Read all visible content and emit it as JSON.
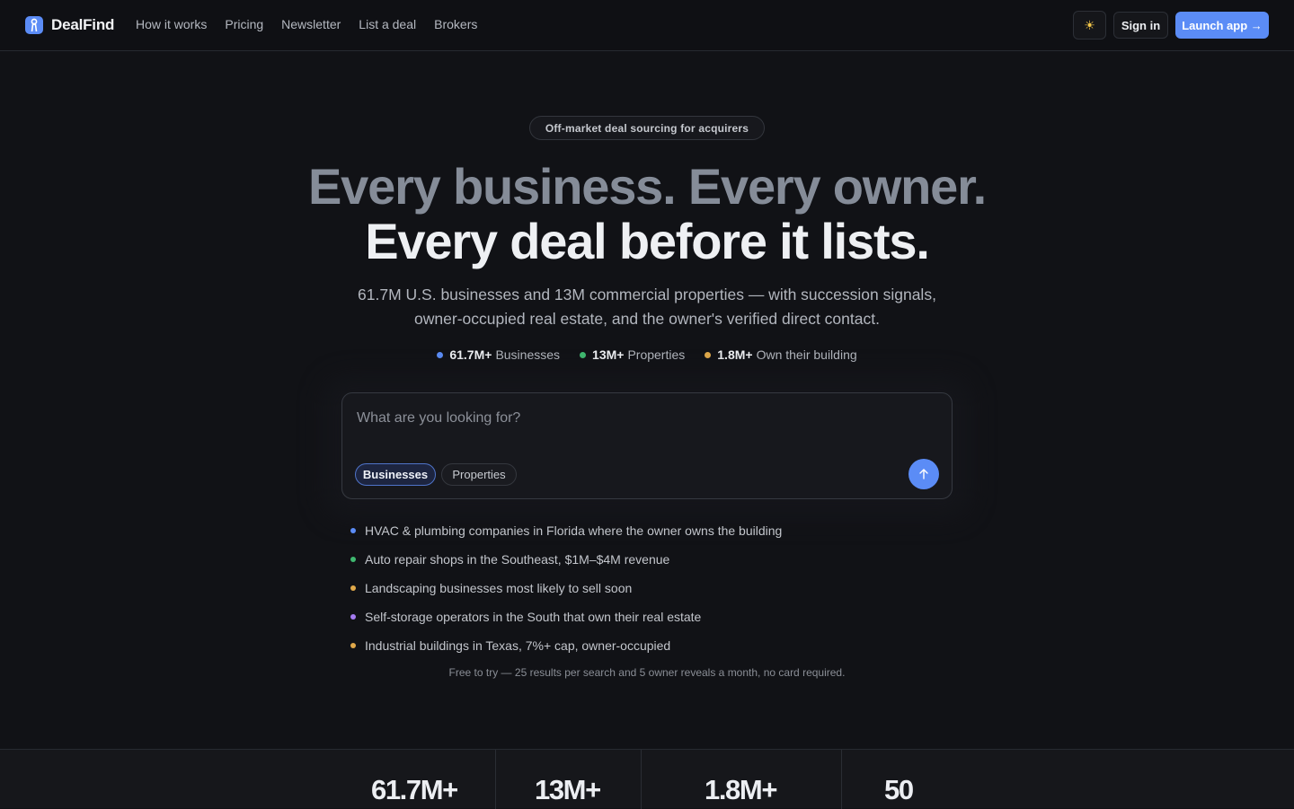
{
  "brand": {
    "name": "DealFind",
    "logo_icon": "person-key-icon",
    "accent": "#5b8cf6"
  },
  "nav": {
    "links": [
      "How it works",
      "Pricing",
      "Newsletter",
      "List a deal",
      "Brokers"
    ],
    "theme_toggle_icon": "sun-icon",
    "sign_in_label": "Sign in",
    "launch_label": "Launch app →"
  },
  "hero": {
    "eyebrow": "Off-market deal sourcing for acquirers",
    "headline_line1": "Every business. Every owner.",
    "headline_line2": "Every deal before it lists.",
    "subhead": "61.7M U.S. businesses and 13M commercial properties — with succession signals, owner-occupied real estate, and the owner's verified direct contact.",
    "stats": [
      {
        "value": "61.7M+",
        "label": "Businesses",
        "color": "#5b8cf6"
      },
      {
        "value": "13M+",
        "label": "Properties",
        "color": "#3fb970"
      },
      {
        "value": "1.8M+",
        "label": "Own their building",
        "color": "#e0a94a"
      }
    ]
  },
  "search": {
    "placeholder": "What are you looking for?",
    "value": "",
    "tabs": [
      {
        "label": "Businesses",
        "selected": true
      },
      {
        "label": "Properties",
        "selected": false
      }
    ],
    "submit_icon": "arrow-up-icon"
  },
  "suggestions": [
    {
      "text": "HVAC & plumbing companies in Florida where the owner owns the building",
      "color": "#5b8cf6"
    },
    {
      "text": "Auto repair shops in the Southeast, $1M–$4M revenue",
      "color": "#3fb970"
    },
    {
      "text": "Landscaping businesses most likely to sell soon",
      "color": "#e0a94a"
    },
    {
      "text": "Self-storage operators in the South that own their real estate",
      "color": "#a57cf2"
    },
    {
      "text": "Industrial buildings in Texas, 7%+ cap, owner-occupied",
      "color": "#e0a94a"
    }
  ],
  "fineprint": "Free to try — 25 results per search and 5 owner reveals a month, no card required.",
  "stat_band": [
    "61.7M+",
    "13M+",
    "1.8M+",
    "50"
  ]
}
